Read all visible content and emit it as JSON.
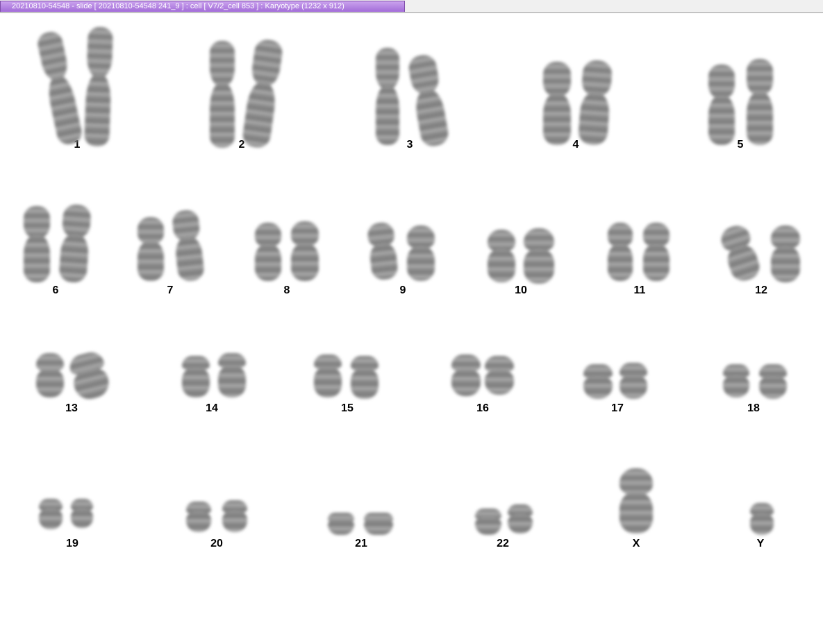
{
  "window": {
    "title": "20210810-54548 - slide [ 20210810-54548 241_9 ] : cell [ V7/2_cell 853 ] : Karyotype  (1232 x 912)"
  },
  "karyotype": {
    "labels": [
      "1",
      "2",
      "3",
      "4",
      "5",
      "6",
      "7",
      "8",
      "9",
      "10",
      "11",
      "12",
      "13",
      "14",
      "15",
      "16",
      "17",
      "18",
      "19",
      "20",
      "21",
      "22",
      "X",
      "Y"
    ]
  },
  "colors": {
    "title_tab": "#b07ee0",
    "chromosome": "#7a7a7a",
    "label": "#000000"
  }
}
